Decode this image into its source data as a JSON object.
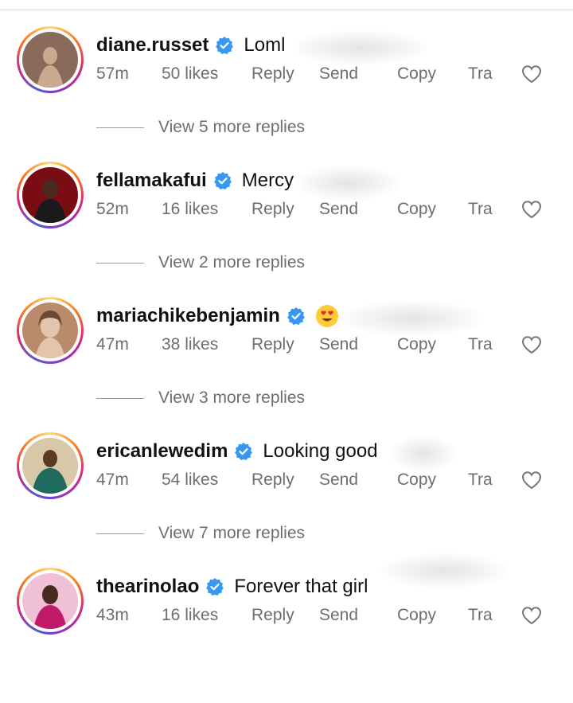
{
  "comments": [
    {
      "username": "diane.russet",
      "text": "Loml",
      "time": "57m",
      "likes": "50 likes",
      "reply": "Reply",
      "send": "Send",
      "copy": "Copy",
      "translate": "Tra",
      "view_replies": "View 5 more replies",
      "avatar_colors": [
        "#8a6a5a",
        "#c9a98f"
      ]
    },
    {
      "username": "fellamakafui",
      "text": "Mercy",
      "time": "52m",
      "likes": "16 likes",
      "reply": "Reply",
      "send": "Send",
      "copy": "Copy",
      "translate": "Tra",
      "view_replies": "View 2 more replies",
      "avatar_colors": [
        "#7a0d14",
        "#1a1a1a"
      ]
    },
    {
      "username": "mariachikebenjamin",
      "text": "",
      "time": "47m",
      "likes": "38 likes",
      "reply": "Reply",
      "send": "Send",
      "copy": "Copy",
      "translate": "Tra",
      "view_replies": "View 3 more replies",
      "avatar_colors": [
        "#b98a6c",
        "#e3c5ad"
      ],
      "emoji": "heart-eyes-emoji"
    },
    {
      "username": "ericanlewedim",
      "text": "Looking good",
      "time": "47m",
      "likes": "54 likes",
      "reply": "Reply",
      "send": "Send",
      "copy": "Copy",
      "translate": "Tra",
      "view_replies": "View 7 more replies",
      "avatar_colors": [
        "#1f6b5e",
        "#d7c9a8"
      ]
    },
    {
      "username": "thearinolao",
      "text": "Forever that girl",
      "time": "43m",
      "likes": "16 likes",
      "reply": "Reply",
      "send": "Send",
      "copy": "Copy",
      "translate": "Tra",
      "avatar_colors": [
        "#c21a6b",
        "#f0c0d6"
      ]
    }
  ],
  "colors": {
    "verified": "#3897f0",
    "meta_text": "#6e6e6e",
    "username": "#111111"
  }
}
